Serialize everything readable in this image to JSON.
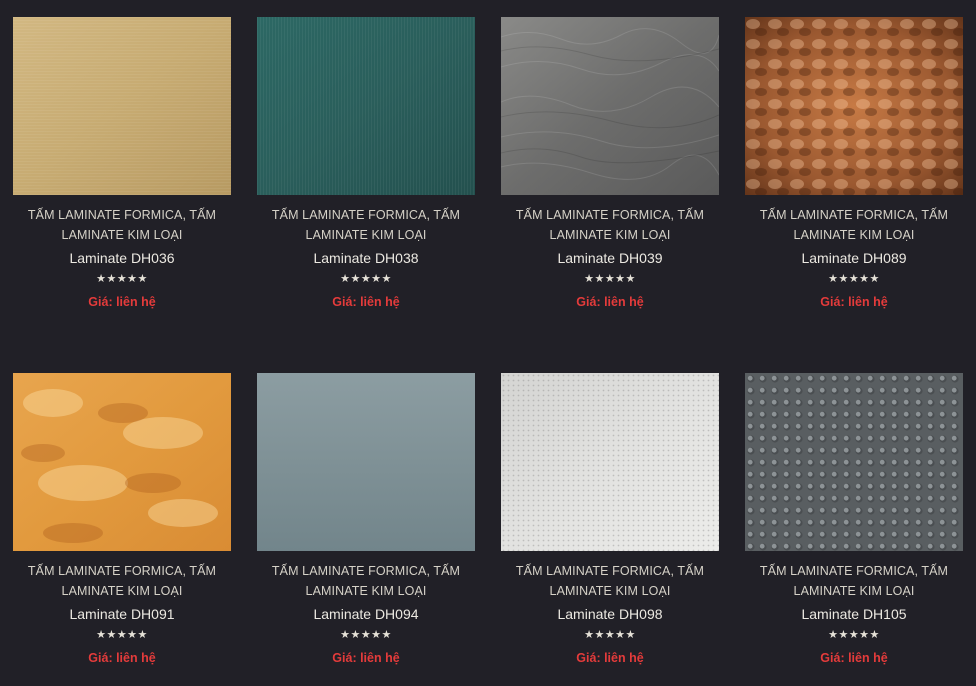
{
  "products": [
    {
      "category": "TẤM LAMINATE FORMICA, TẤM LAMINATE KIM LOẠI",
      "title": "Laminate DH036",
      "rating": "★★★★★",
      "price": "Giá: liên hệ",
      "swatch": "gold-brushed"
    },
    {
      "category": "TẤM LAMINATE FORMICA, TẤM LAMINATE KIM LOẠI",
      "title": "Laminate DH038",
      "rating": "★★★★★",
      "price": "Giá: liên hệ",
      "swatch": "teal-brushed"
    },
    {
      "category": "TẤM LAMINATE FORMICA, TẤM LAMINATE KIM LOẠI",
      "title": "Laminate DH039",
      "rating": "★★★★★",
      "price": "Giá: liên hệ",
      "swatch": "grey-wave"
    },
    {
      "category": "TẤM LAMINATE FORMICA, TẤM LAMINATE KIM LOẠI",
      "title": "Laminate DH089",
      "rating": "★★★★★",
      "price": "Giá: liên hệ",
      "swatch": "copper-hammered"
    },
    {
      "category": "TẤM LAMINATE FORMICA, TẤM LAMINATE KIM LOẠI",
      "title": "Laminate DH091",
      "rating": "★★★★★",
      "price": "Giá: liên hệ",
      "swatch": "orange-marble"
    },
    {
      "category": "TẤM LAMINATE FORMICA, TẤM LAMINATE KIM LOẠI",
      "title": "Laminate DH094",
      "rating": "★★★★★",
      "price": "Giá: liên hệ",
      "swatch": "blue-grey"
    },
    {
      "category": "TẤM LAMINATE FORMICA, TẤM LAMINATE KIM LOẠI",
      "title": "Laminate DH098",
      "rating": "★★★★★",
      "price": "Giá: liên hệ",
      "swatch": "white-dotted"
    },
    {
      "category": "TẤM LAMINATE FORMICA, TẤM LAMINATE KIM LOẠI",
      "title": "Laminate DH105",
      "rating": "★★★★★",
      "price": "Giá: liên hệ",
      "swatch": "grey-bubble"
    }
  ],
  "colors": {
    "background": "#212027",
    "price": "#e43b3b",
    "text": "#ece9e2"
  }
}
